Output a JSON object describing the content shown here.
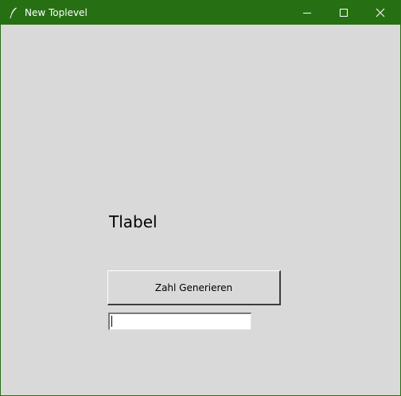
{
  "window": {
    "title": "New Toplevel",
    "app_icon": "feather-icon",
    "controls": {
      "minimize_icon": "minimize-icon",
      "maximize_icon": "maximize-icon",
      "close_icon": "close-icon"
    }
  },
  "content": {
    "label_text": "Tlabel",
    "button_label": "Zahl Generieren",
    "entry_value": ""
  },
  "colors": {
    "titlebar": "#267013",
    "background": "#d9d9d9"
  }
}
